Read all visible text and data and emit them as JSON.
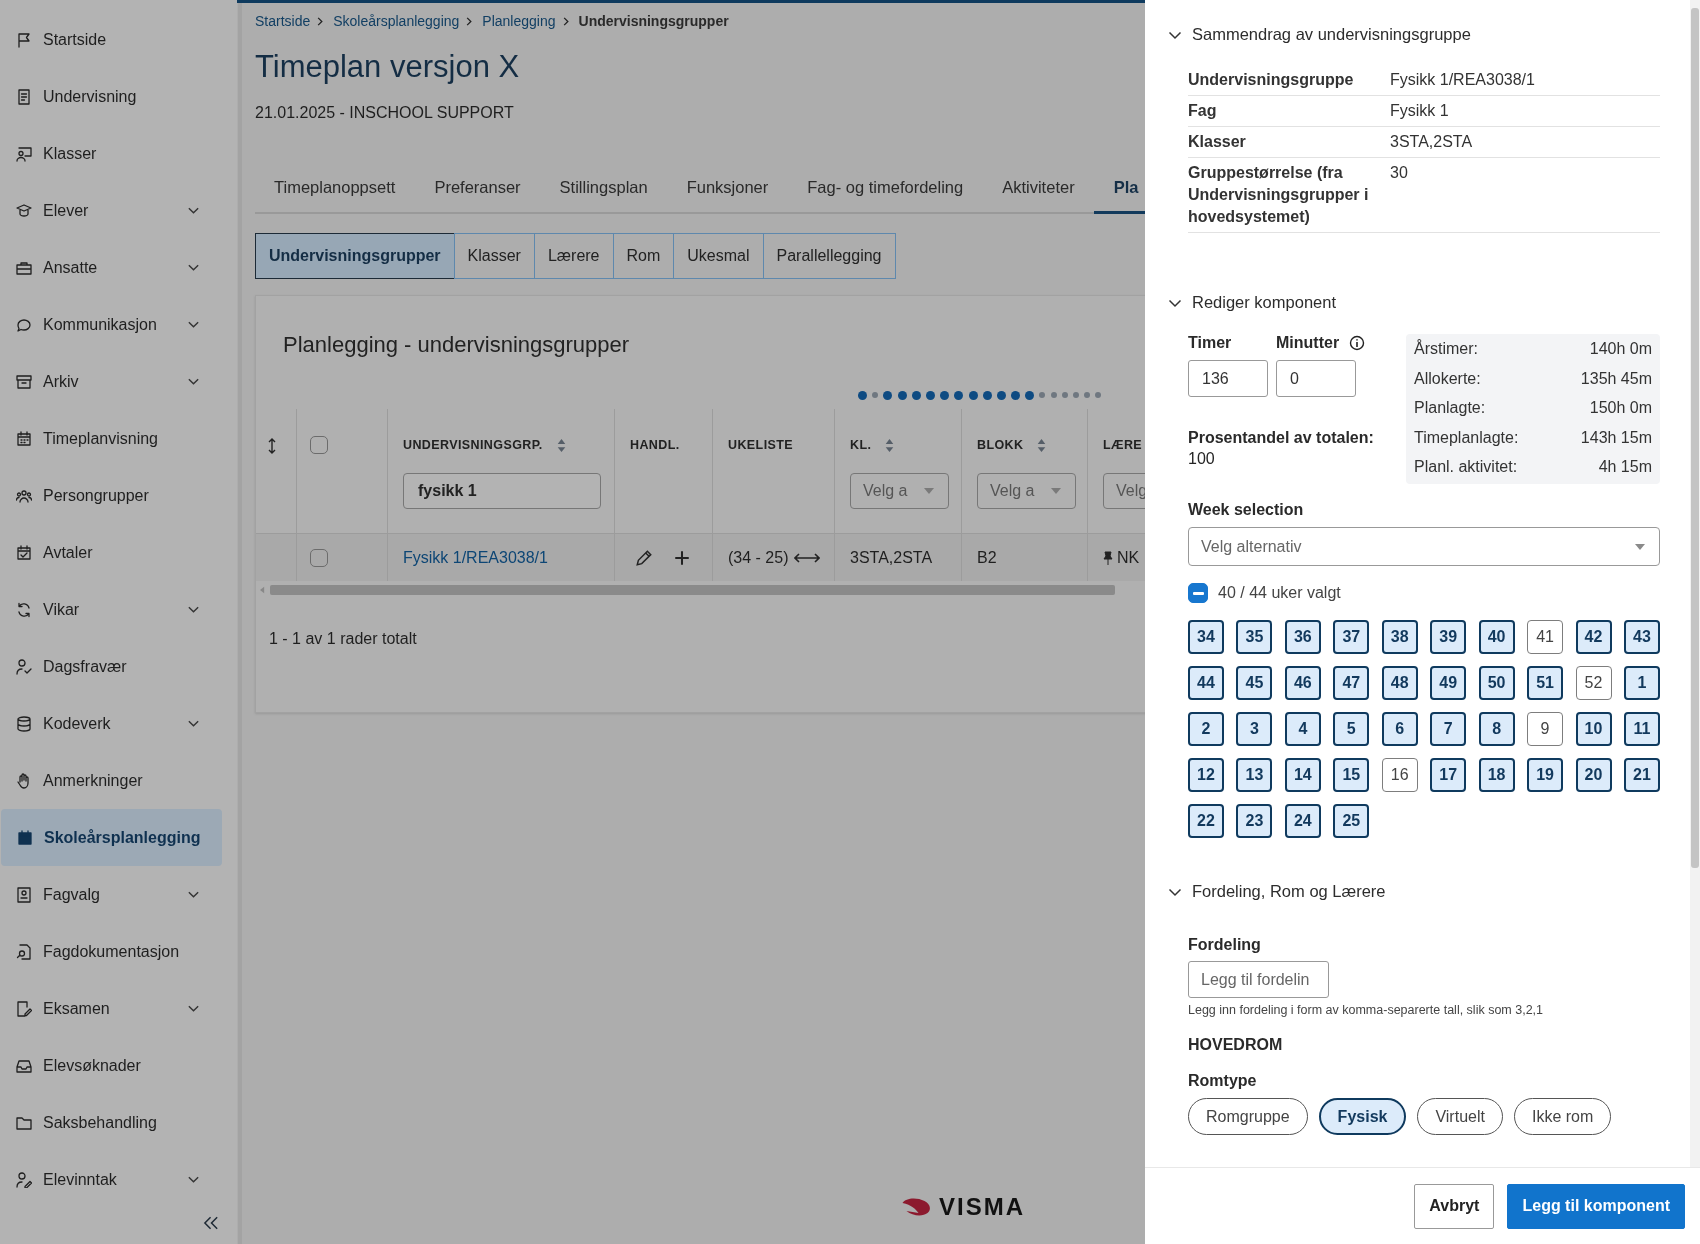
{
  "sidebar": {
    "items": [
      {
        "label": "Startside",
        "expandable": false,
        "selected": false
      },
      {
        "label": "Undervisning",
        "expandable": false,
        "selected": false
      },
      {
        "label": "Klasser",
        "expandable": false,
        "selected": false
      },
      {
        "label": "Elever",
        "expandable": true,
        "selected": false
      },
      {
        "label": "Ansatte",
        "expandable": true,
        "selected": false
      },
      {
        "label": "Kommunikasjon",
        "expandable": true,
        "selected": false
      },
      {
        "label": "Arkiv",
        "expandable": true,
        "selected": false
      },
      {
        "label": "Timeplanvisning",
        "expandable": false,
        "selected": false
      },
      {
        "label": "Persongrupper",
        "expandable": false,
        "selected": false
      },
      {
        "label": "Avtaler",
        "expandable": false,
        "selected": false
      },
      {
        "label": "Vikar",
        "expandable": true,
        "selected": false
      },
      {
        "label": "Dagsfravær",
        "expandable": false,
        "selected": false
      },
      {
        "label": "Kodeverk",
        "expandable": true,
        "selected": false
      },
      {
        "label": "Anmerkninger",
        "expandable": false,
        "selected": false
      },
      {
        "label": "Skoleårsplanlegging",
        "expandable": false,
        "selected": true
      },
      {
        "label": "Fagvalg",
        "expandable": true,
        "selected": false
      },
      {
        "label": "Fagdokumentasjon",
        "expandable": false,
        "selected": false
      },
      {
        "label": "Eksamen",
        "expandable": true,
        "selected": false
      },
      {
        "label": "Elevsøknader",
        "expandable": false,
        "selected": false
      },
      {
        "label": "Saksbehandling",
        "expandable": false,
        "selected": false
      },
      {
        "label": "Elevinntak",
        "expandable": true,
        "selected": false
      }
    ]
  },
  "breadcrumb": [
    {
      "label": "Startside",
      "current": false
    },
    {
      "label": "Skoleårsplanlegging",
      "current": false
    },
    {
      "label": "Planlegging",
      "current": false
    },
    {
      "label": "Undervisningsgrupper",
      "current": true
    }
  ],
  "page": {
    "title": "Timeplan versjon X",
    "subtitle": "21.01.2025 - INSCHOOL SUPPORT"
  },
  "tabs": [
    {
      "label": "Timeplanoppsett",
      "selected": false
    },
    {
      "label": "Preferanser",
      "selected": false
    },
    {
      "label": "Stillingsplan",
      "selected": false
    },
    {
      "label": "Funksjoner",
      "selected": false
    },
    {
      "label": "Fag- og timefordeling",
      "selected": false
    },
    {
      "label": "Aktiviteter",
      "selected": false
    },
    {
      "label": "Pla",
      "selected": true
    }
  ],
  "subtabs": [
    {
      "label": "Undervisningsgrupper",
      "selected": true
    },
    {
      "label": "Klasser",
      "selected": false
    },
    {
      "label": "Lærere",
      "selected": false
    },
    {
      "label": "Rom",
      "selected": false
    },
    {
      "label": "Ukesmal",
      "selected": false
    },
    {
      "label": "Parallellegging",
      "selected": false
    }
  ],
  "card": {
    "title": "Planlegging - undervisningsgrupper",
    "dots": [
      {
        "active": true
      },
      {
        "active": false
      },
      {
        "active": true
      },
      {
        "active": true
      },
      {
        "active": true
      },
      {
        "active": true
      },
      {
        "active": true
      },
      {
        "active": true
      },
      {
        "active": true
      },
      {
        "active": true
      },
      {
        "active": true
      },
      {
        "active": true
      },
      {
        "active": true
      },
      {
        "active": false
      },
      {
        "active": false
      },
      {
        "active": false
      },
      {
        "active": false
      },
      {
        "active": false
      },
      {
        "active": false
      }
    ],
    "table": {
      "select_all": {
        "checked": false
      },
      "columns": [
        {
          "label": "UNDERVISNINGSGRP.",
          "sortable": true,
          "kind": "input",
          "value": "fysikk 1"
        },
        {
          "label": "HANDL.",
          "sortable": false,
          "kind": "none"
        },
        {
          "label": "UKELISTE",
          "sortable": false,
          "kind": "none"
        },
        {
          "label": "KL.",
          "sortable": true,
          "kind": "select",
          "placeholder": "Velg a"
        },
        {
          "label": "BLOKK",
          "sortable": true,
          "kind": "select",
          "placeholder": "Velg a"
        },
        {
          "label": "LÆRE",
          "sortable": false,
          "kind": "select",
          "placeholder": "Velg"
        }
      ],
      "rows": [
        {
          "checked": false,
          "group": "Fysikk 1/REA3038/1",
          "weeks": "(34 - 25)",
          "classes": "3STA,2STA",
          "block": "B2",
          "teacher": "NK"
        }
      ]
    },
    "footer": "1 - 1 av 1 rader totalt"
  },
  "logo": {
    "text": "VISMA"
  },
  "panel": {
    "summary": {
      "title": "Sammendrag av undervisningsgruppe",
      "expanded": true,
      "rows": [
        {
          "label": "Undervisningsgruppe",
          "value": "Fysikk 1/REA3038/1"
        },
        {
          "label": "Fag",
          "value": "Fysikk 1"
        },
        {
          "label": "Klasser",
          "value": "3STA,2STA"
        },
        {
          "label": "Gruppestørrelse (fra Undervisningsgrupper i hovedsystemet)",
          "value": "30"
        }
      ]
    },
    "edit": {
      "title": "Rediger komponent",
      "expanded": true,
      "timer_label": "Timer",
      "timer_value": "136",
      "minutes_label": "Minutter",
      "minutes_value": "0",
      "percent_label": "Prosentandel av totalen:",
      "percent_value": "100",
      "stats": [
        {
          "label": "Årstimer:",
          "value": "140h 0m"
        },
        {
          "label": "Allokerte:",
          "value": "135h 45m"
        },
        {
          "label": "Planlagte:",
          "value": "150h 0m"
        },
        {
          "label": "Timeplanlagte:",
          "value": "143h 15m"
        },
        {
          "label": "Planl. aktivitet:",
          "value": "4h 15m"
        }
      ],
      "week_label": "Week selection",
      "week_placeholder": "Velg alternativ",
      "weeks_indeterminate": true,
      "weeks_count": "40 / 44 uker valgt",
      "weeks": [
        {
          "label": "34",
          "selected": true
        },
        {
          "label": "35",
          "selected": true
        },
        {
          "label": "36",
          "selected": true
        },
        {
          "label": "37",
          "selected": true
        },
        {
          "label": "38",
          "selected": true
        },
        {
          "label": "39",
          "selected": true
        },
        {
          "label": "40",
          "selected": true
        },
        {
          "label": "41",
          "selected": false
        },
        {
          "label": "42",
          "selected": true
        },
        {
          "label": "43",
          "selected": true
        },
        {
          "label": "44",
          "selected": true
        },
        {
          "label": "45",
          "selected": true
        },
        {
          "label": "46",
          "selected": true
        },
        {
          "label": "47",
          "selected": true
        },
        {
          "label": "48",
          "selected": true
        },
        {
          "label": "49",
          "selected": true
        },
        {
          "label": "50",
          "selected": true
        },
        {
          "label": "51",
          "selected": true
        },
        {
          "label": "52",
          "selected": false
        },
        {
          "label": "1",
          "selected": true
        },
        {
          "label": "2",
          "selected": true
        },
        {
          "label": "3",
          "selected": true
        },
        {
          "label": "4",
          "selected": true
        },
        {
          "label": "5",
          "selected": true
        },
        {
          "label": "6",
          "selected": true
        },
        {
          "label": "7",
          "selected": true
        },
        {
          "label": "8",
          "selected": true
        },
        {
          "label": "9",
          "selected": false
        },
        {
          "label": "10",
          "selected": true
        },
        {
          "label": "11",
          "selected": true
        },
        {
          "label": "12",
          "selected": true
        },
        {
          "label": "13",
          "selected": true
        },
        {
          "label": "14",
          "selected": true
        },
        {
          "label": "15",
          "selected": true
        },
        {
          "label": "16",
          "selected": false
        },
        {
          "label": "17",
          "selected": true
        },
        {
          "label": "18",
          "selected": true
        },
        {
          "label": "19",
          "selected": true
        },
        {
          "label": "20",
          "selected": true
        },
        {
          "label": "21",
          "selected": true
        },
        {
          "label": "22",
          "selected": true
        },
        {
          "label": "23",
          "selected": true
        },
        {
          "label": "24",
          "selected": true
        },
        {
          "label": "25",
          "selected": true
        }
      ]
    },
    "distribution": {
      "title": "Fordeling, Rom og Lærere",
      "expanded": true,
      "fordeling_label": "Fordeling",
      "fordeling_placeholder": "Legg til fordelin",
      "hint": "Legg inn fordeling i form av komma-separerte tall, slik som 3,2,1",
      "main_room": "HOVEDROM",
      "room_type_label": "Romtype",
      "room_types": [
        {
          "label": "Romgruppe",
          "selected": false
        },
        {
          "label": "Fysisk",
          "selected": true
        },
        {
          "label": "Virtuelt",
          "selected": false
        },
        {
          "label": "Ikke rom",
          "selected": false
        }
      ]
    },
    "buttons": [
      {
        "label": "Avbryt",
        "kind": "secondary"
      },
      {
        "label": "Legg til komponent",
        "kind": "primary"
      }
    ]
  }
}
